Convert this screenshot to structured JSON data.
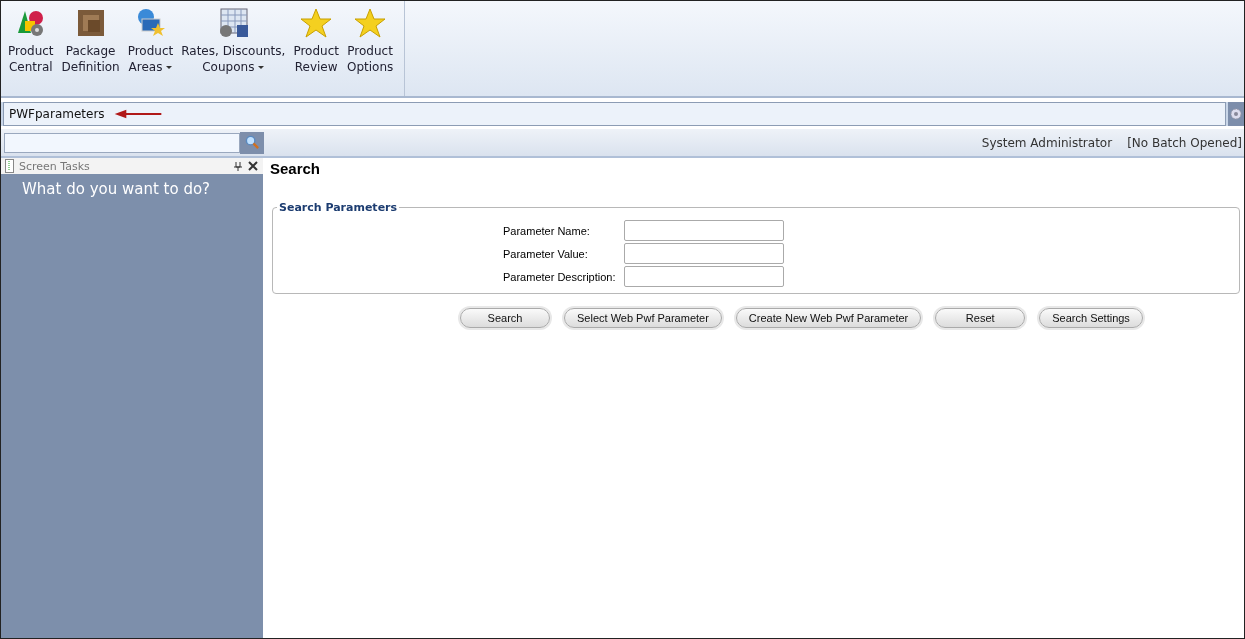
{
  "ribbon": {
    "items": [
      {
        "lines": [
          "Product",
          "Central"
        ],
        "dropdown": false
      },
      {
        "lines": [
          "Package",
          "Definition"
        ],
        "dropdown": false
      },
      {
        "lines": [
          "Product",
          "Areas"
        ],
        "dropdown": true
      },
      {
        "lines": [
          "Rates, Discounts,",
          "Coupons"
        ],
        "dropdown": true
      },
      {
        "lines": [
          "Product",
          "Review"
        ],
        "dropdown": false
      },
      {
        "lines": [
          "Product",
          "Options"
        ],
        "dropdown": false
      }
    ]
  },
  "address_bar": {
    "value": "PWFparameters"
  },
  "search_row": {
    "user": "System Administrator",
    "batch": "[No Batch Opened]"
  },
  "task_pane": {
    "title": "Screen Tasks",
    "prompt": "What do you want to do?"
  },
  "content": {
    "title": "Search",
    "group_title": "Search Parameters",
    "fields": [
      {
        "label": "Parameter Name:"
      },
      {
        "label": "Parameter Value:"
      },
      {
        "label": "Parameter Description:"
      }
    ],
    "buttons": [
      "Search",
      "Select Web Pwf Parameter",
      "Create New Web Pwf Parameter",
      "Reset",
      "Search Settings"
    ]
  }
}
